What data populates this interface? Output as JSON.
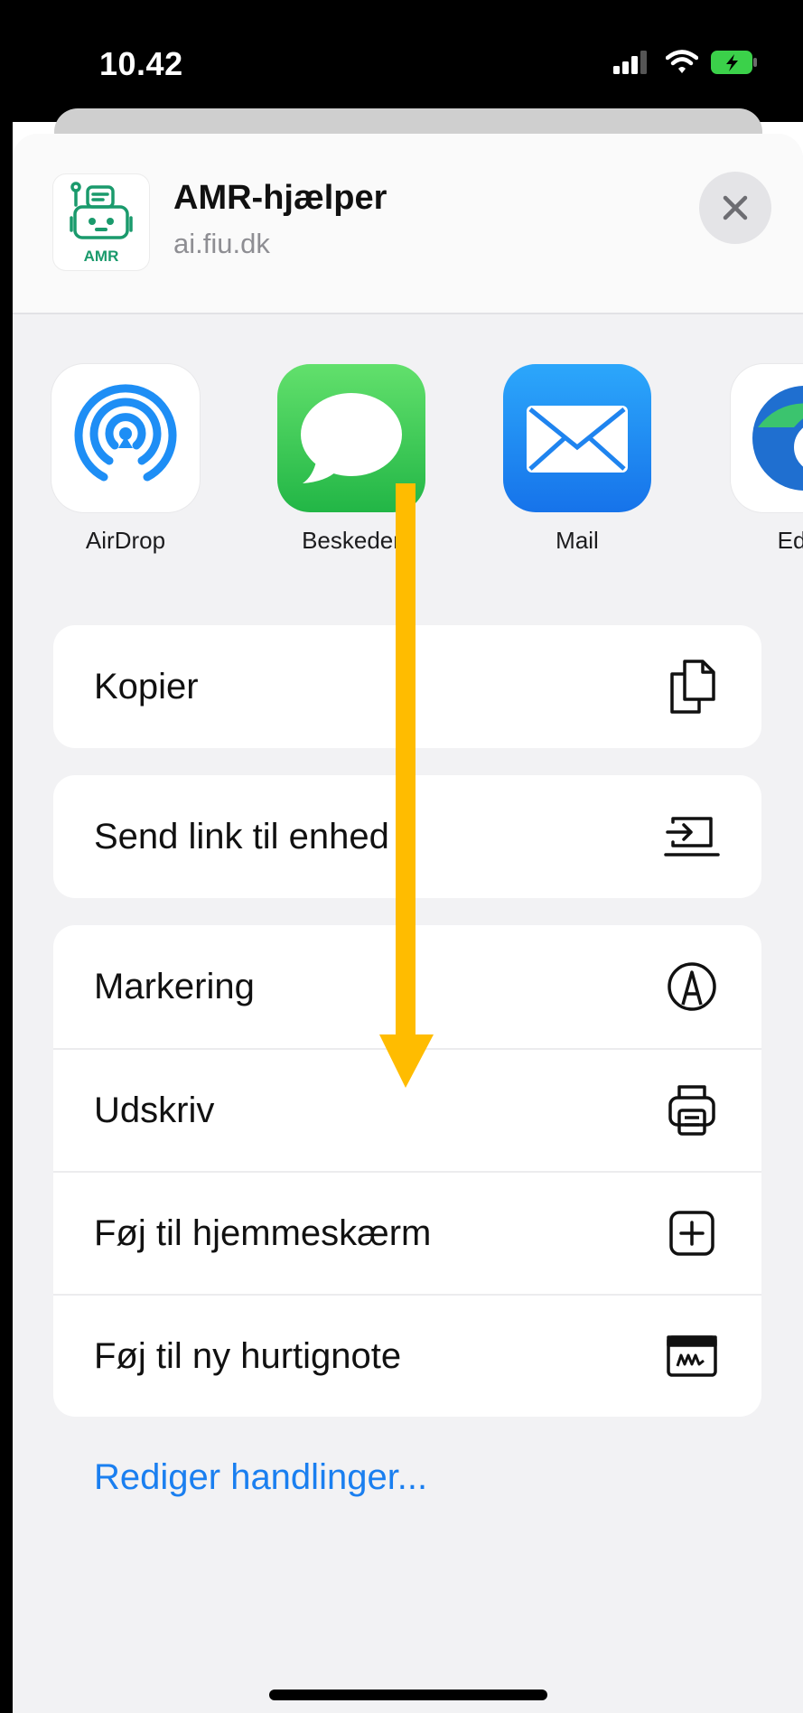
{
  "status_bar": {
    "time": "10.42"
  },
  "site": {
    "title": "AMR-hjælper",
    "domain": "ai.fiu.dk",
    "icon_text": "AMR"
  },
  "share_targets": [
    {
      "label": "AirDrop",
      "icon": "airdrop-icon"
    },
    {
      "label": "Beskeder",
      "icon": "messages-icon"
    },
    {
      "label": "Mail",
      "icon": "mail-icon"
    },
    {
      "label": "Edge",
      "icon": "edge-icon"
    }
  ],
  "actions": {
    "copy": {
      "label": "Kopier",
      "icon": "copy-icon"
    },
    "send_link": {
      "label": "Send link til enhed",
      "icon": "send-to-device-icon"
    },
    "markup": {
      "label": "Markering",
      "icon": "markup-icon"
    },
    "print": {
      "label": "Udskriv",
      "icon": "printer-icon"
    },
    "add_home": {
      "label": "Føj til hjemmeskærm",
      "icon": "add-square-icon"
    },
    "quick_note": {
      "label": "Føj til ny hurtignote",
      "icon": "quick-note-icon"
    }
  },
  "edit_actions_label": "Rediger handlinger...",
  "colors": {
    "link_blue": "#1a7ff0",
    "annotation_arrow": "#ffbc00",
    "messages_green": "#34c759",
    "mail_blue": "#1e8ef5",
    "brand_teal": "#1a9a6c"
  }
}
